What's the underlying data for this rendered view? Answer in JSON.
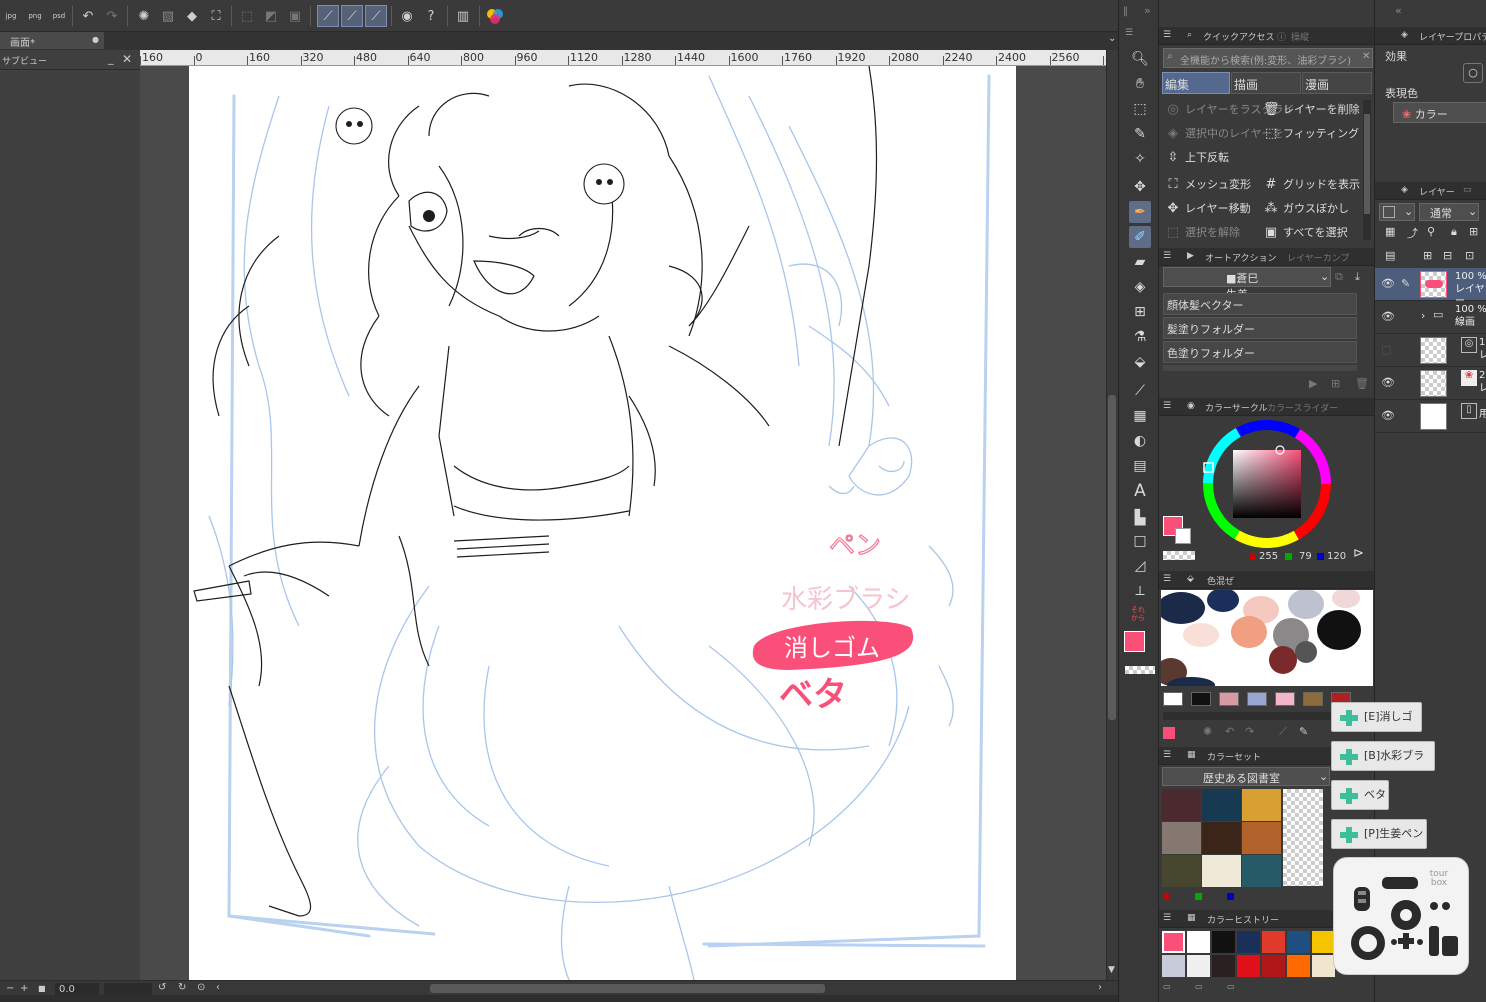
{
  "toolbar": {
    "export_labels": [
      "jpg",
      "png",
      "psd"
    ],
    "icons": [
      "export-jpg-icon",
      "export-png-icon",
      "export-psd-icon",
      "undo-icon",
      "redo-icon",
      "loading-icon",
      "clear-icon",
      "fill-icon",
      "transform-icon",
      "deselect-icon",
      "invert-selection-icon",
      "expand-selection-icon",
      "snap-ruler-icon",
      "snap-special-ruler-icon",
      "snap-grid-icon",
      "cup-icon",
      "help-icon",
      "tablet-icon",
      "color-icon"
    ]
  },
  "document": {
    "tab_title": "画面*",
    "subview_title": "サブビュー",
    "zoom": "0.0"
  },
  "ruler": {
    "ticks": [
      "160",
      "0",
      "160",
      "320",
      "480",
      "640",
      "800",
      "960",
      "1120",
      "1280",
      "1440",
      "1600",
      "1760",
      "1920",
      "2080",
      "2240",
      "2400",
      "2560",
      "2"
    ]
  },
  "quick_access": {
    "title": "クイックアクセス",
    "title2": "操縦",
    "search_placeholder": "全機能から検索(例:変形、油彩ブラシ)",
    "tabs": [
      "編集",
      "描画",
      "漫画"
    ],
    "items": [
      {
        "label": "レイヤーをラスタライ",
        "dim": true
      },
      {
        "label": "レイヤーを削除",
        "dim": false
      },
      {
        "label": "選択中のレイヤーを",
        "dim": true
      },
      {
        "label": "フィッティング",
        "dim": false
      },
      {
        "label": "上下反転",
        "dim": false
      },
      {
        "label": "メッシュ変形",
        "dim": false
      },
      {
        "label": "グリッドを表示",
        "dim": false
      },
      {
        "label": "レイヤー移動",
        "dim": false
      },
      {
        "label": "ガウスぼかし",
        "dim": false
      },
      {
        "label": "選択を解除",
        "dim": true
      },
      {
        "label": "すべてを選択",
        "dim": false
      }
    ]
  },
  "auto_action": {
    "title": "オートアクション",
    "title2": "レイヤーカンプ",
    "set": "■蒼巳生姜",
    "items": [
      "顔体髪ベクター",
      "髪塗りフォルダー",
      "色塗りフォルダー"
    ]
  },
  "color_circle": {
    "title": "カラーサークル",
    "title2": "カラースライダー",
    "r": "255",
    "g": "79",
    "b": "120",
    "main_color": "#f94f78"
  },
  "color_mix": {
    "title": "色混ぜ",
    "palette": [
      "#ffffff",
      "#111111",
      "#d99aa5",
      "#9aa5d4",
      "#f5b5c8",
      "#8c6a3a",
      "#b02020"
    ]
  },
  "color_set": {
    "title": "カラーセット",
    "set_name": "歴史ある図書室",
    "swatches": [
      "#4a2a2e",
      "#173a52",
      "#d8a033",
      "#857870",
      "#3b2418",
      "#b2622b",
      "#474730",
      "#efe9d8",
      "#255a66"
    ]
  },
  "color_history": {
    "title": "カラーヒストリー",
    "swatches_row1": [
      "#f94f78",
      "#ffffff",
      "#111111",
      "#1a2f5a",
      "#e03a2a",
      "#1f4f80",
      "#f5c400"
    ],
    "swatches_row2": [
      "#c8ccd8",
      "#f0f0f0",
      "#2a2020",
      "#e0101a",
      "#b01818",
      "#ff6a00",
      "#f0e6d0"
    ]
  },
  "layer_property": {
    "title": "レイヤープロパティ",
    "effect_label": "効果",
    "expression_label": "表現色",
    "expression_value": "カラー"
  },
  "layers": {
    "title": "レイヤー",
    "blend_mode": "通常",
    "rows": [
      {
        "opacity": "100 %",
        "name": "レイヤー",
        "visible": true
      },
      {
        "opacity": "100 %",
        "name": "線画",
        "visible": true
      },
      {
        "opacity": "1",
        "name": "レ",
        "visible": false
      },
      {
        "opacity": "2",
        "name": "レ",
        "visible": true
      },
      {
        "opacity": "",
        "name": "用",
        "visible": true
      }
    ]
  },
  "canvas_notes": {
    "pen": "ペン",
    "watercolor": "水彩ブラシ",
    "eraser": "消しゴム",
    "fill": "ベタ"
  },
  "tourbox": {
    "brand": "tour box",
    "popups": [
      "[E]消しゴム",
      "[B]水彩ブラシ",
      "ベタ",
      "[P]生姜ペン"
    ]
  },
  "tool_colors": {
    "main": "#f94f78",
    "sub": "#ffffff"
  }
}
